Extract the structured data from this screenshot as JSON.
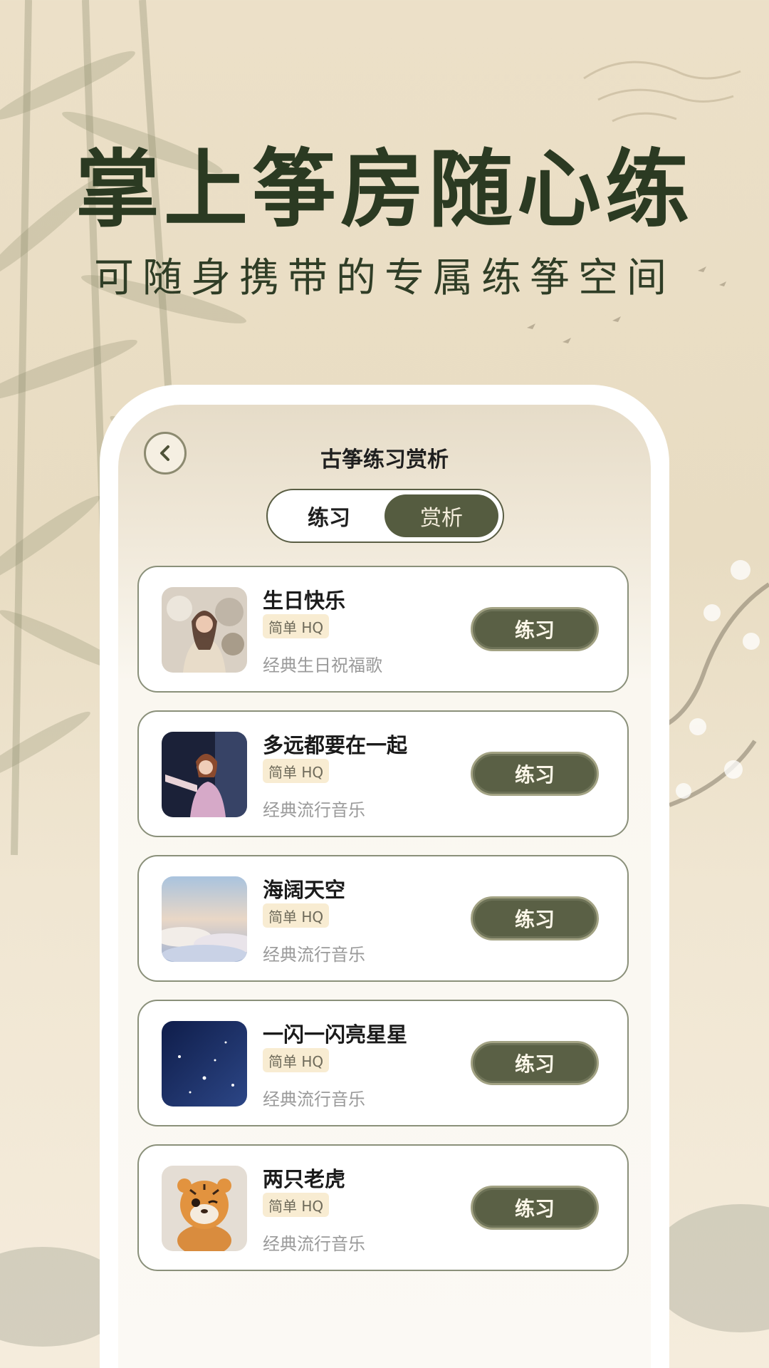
{
  "banner": {
    "headline": "掌上筝房随心练",
    "subline": "可随身携带的专属练筝空间"
  },
  "screen": {
    "title": "古筝练习赏析",
    "back_icon": "chevron-left-icon",
    "tabs": [
      {
        "label": "练习",
        "active": false
      },
      {
        "label": "赏析",
        "active": true
      }
    ]
  },
  "songs": [
    {
      "title": "生日快乐",
      "badge": "简单 HQ",
      "desc": "经典生日祝福歌",
      "button": "练习",
      "thumb": "birthday-girl-photo"
    },
    {
      "title": "多远都要在一起",
      "badge": "简单 HQ",
      "desc": "经典流行音乐",
      "button": "练习",
      "thumb": "singer-on-stage-photo"
    },
    {
      "title": "海阔天空",
      "badge": "简单 HQ",
      "desc": "经典流行音乐",
      "button": "练习",
      "thumb": "sky-clouds-photo"
    },
    {
      "title": "一闪一闪亮星星",
      "badge": "简单 HQ",
      "desc": "经典流行音乐",
      "button": "练习",
      "thumb": "starry-night-photo"
    },
    {
      "title": "两只老虎",
      "badge": "简单 HQ",
      "desc": "经典流行音乐",
      "button": "练习",
      "thumb": "cartoon-tiger-image"
    }
  ],
  "colors": {
    "headline": "#2b3a22",
    "accent_button": "#5a6045",
    "card_border": "#8a907a"
  }
}
